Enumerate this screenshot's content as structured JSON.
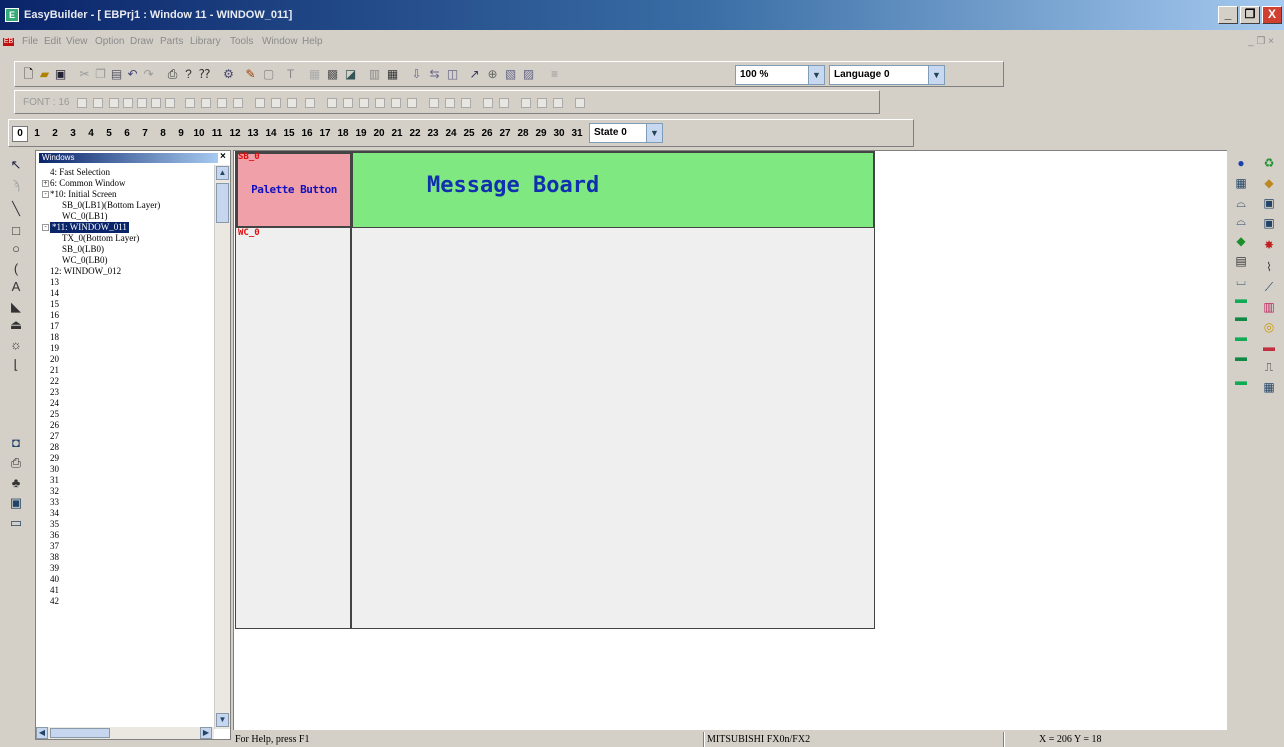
{
  "window": {
    "title": "EasyBuilder - [ EBPrj1 : Window 11 - WINDOW_011]",
    "app_icon": "easybuilder-icon",
    "buttons": [
      "_",
      "❐",
      "X"
    ]
  },
  "menu": {
    "items": [
      "File",
      "Edit",
      "View",
      "Option",
      "Draw",
      "Parts",
      "Library",
      "Tools",
      "Window",
      "Help"
    ],
    "mdi_controls": "_ ❐ ×"
  },
  "toolbar": {
    "zoom": "100 %",
    "language": "Language 0"
  },
  "format_bar": {
    "font_label": "FONT : 16"
  },
  "layer_bar": {
    "numbers": [
      "0",
      "1",
      "2",
      "3",
      "4",
      "5",
      "6",
      "7",
      "8",
      "9",
      "10",
      "11",
      "12",
      "13",
      "14",
      "15",
      "16",
      "17",
      "18",
      "19",
      "20",
      "21",
      "22",
      "23",
      "24",
      "25",
      "26",
      "27",
      "28",
      "29",
      "30",
      "31"
    ],
    "selected": "0",
    "state": "State 0"
  },
  "tree": {
    "header": "Windows",
    "rows": [
      "4: Fast Selection",
      "6: Common Window",
      "*10: Initial Screen",
      "SB_0(LB1)(Bottom Layer)",
      "WC_0(LB1)",
      "*11: WINDOW_011",
      "TX_0(Bottom Layer)",
      "SB_0(LB0)",
      "WC_0(LB0)",
      "12: WINDOW_012",
      "13",
      "14",
      "15",
      "16",
      "17",
      "18",
      "19",
      "20",
      "21",
      "22",
      "23",
      "24",
      "25",
      "26",
      "27",
      "28",
      "29",
      "30",
      "31",
      "32",
      "33",
      "34",
      "35",
      "36",
      "37",
      "38",
      "39",
      "40",
      "41",
      "42"
    ]
  },
  "canvas": {
    "palette_button": "Palette Button",
    "message_board": "Message Board",
    "sb_tag": "SB_0",
    "wc_tag": "WC_0"
  },
  "status": {
    "help": "For Help, press F1",
    "plc": "MITSUBISHI FX0n/FX2",
    "coords": "X = 206  Y = 18"
  }
}
